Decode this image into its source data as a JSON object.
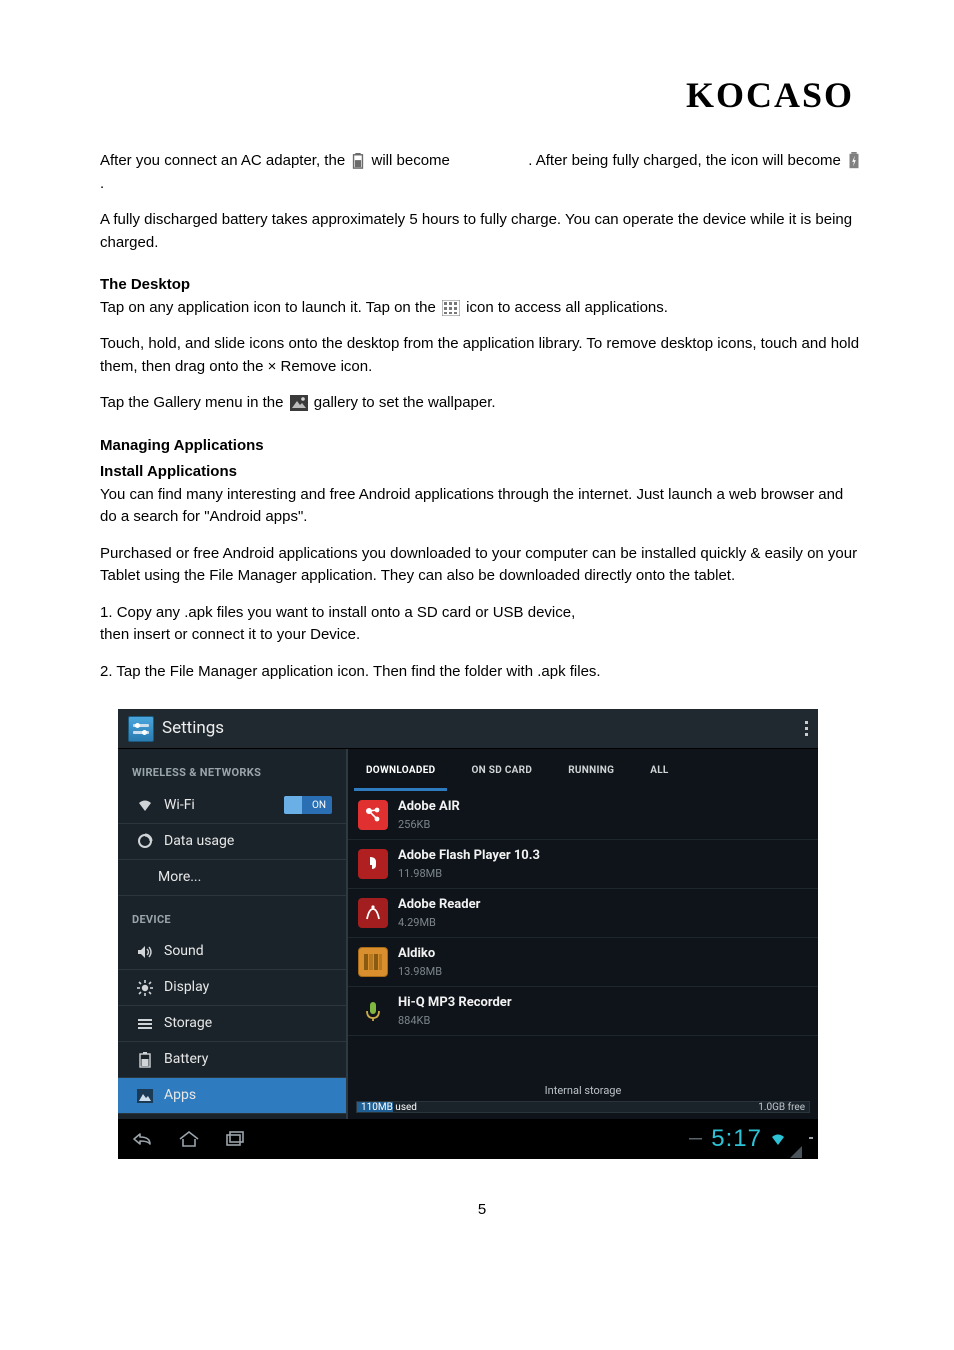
{
  "logo": "KOCASO",
  "paragraphs": {
    "p1_prefix": "After you connect an AC adapter, the ",
    "p1_mid": " will become ",
    "p1_suffix": ". After being fully charged, the icon will become ",
    "p1_end": ".",
    "p2": "A fully discharged battery takes approximately 5 hours to fully charge. You can operate the device while it is being charged."
  },
  "desktop": {
    "heading": "The Desktop",
    "p1_prefix": "Tap on any application icon to launch it. Tap on the ",
    "p1_suffix": " icon to access all applications.",
    "p2": "Touch, hold, and slide icons onto the desktop from the application library. To remove desktop icons, touch and hold them, then drag onto the × Remove icon.",
    "p3_prefix": "Tap the Gallery menu in the ",
    "p3_suffix": " gallery to set the wallpaper."
  },
  "apps": {
    "heading1": "Managing Applications",
    "heading2": "Install Applications",
    "p1": "You can find many interesting and free Android applications through the internet. Just launch a web browser and do a search for \"Android apps\".",
    "p2": "Purchased or free Android applications you downloaded to your computer can be installed quickly & easily on your Tablet using the File Manager application. They can also be downloaded directly onto the tablet.",
    "p3_num": "1. ",
    "p3_a": "Copy any .apk files you want to install onto a SD card or USB device, ",
    "p3_b": "then insert or connect it to your Device.",
    "p4_num": "2. ",
    "p4": "Tap the File Manager application icon.  Then find the folder with .apk files."
  },
  "screenshot": {
    "title": "Settings",
    "sidebar": {
      "section1": "WIRELESS & NETWORKS",
      "wifi": "Wi-Fi",
      "wifi_state": "ON",
      "data_usage": "Data usage",
      "more": "More...",
      "section2": "DEVICE",
      "sound": "Sound",
      "display": "Display",
      "storage": "Storage",
      "battery": "Battery",
      "apps": "Apps"
    },
    "tabs": {
      "downloaded": "DOWNLOADED",
      "sdcard": "ON SD CARD",
      "running": "RUNNING",
      "all": "ALL"
    },
    "app_list": [
      {
        "name": "Adobe AIR",
        "size": "256KB",
        "cls": "ai-air"
      },
      {
        "name": "Adobe Flash Player 10.3",
        "size": "11.98MB",
        "cls": "ai-flash"
      },
      {
        "name": "Adobe Reader",
        "size": "4.29MB",
        "cls": "ai-reader"
      },
      {
        "name": "Aldiko",
        "size": "13.98MB",
        "cls": "ai-aldiko"
      },
      {
        "name": "Hi-Q MP3 Recorder",
        "size": "884KB",
        "cls": "ai-hiq"
      }
    ],
    "storage": {
      "label": "Internal storage",
      "used": "110MB",
      "used_suffix": " used",
      "free": "1.0GB free"
    },
    "navbar": {
      "clock": "5:17"
    }
  },
  "page_number": "5"
}
